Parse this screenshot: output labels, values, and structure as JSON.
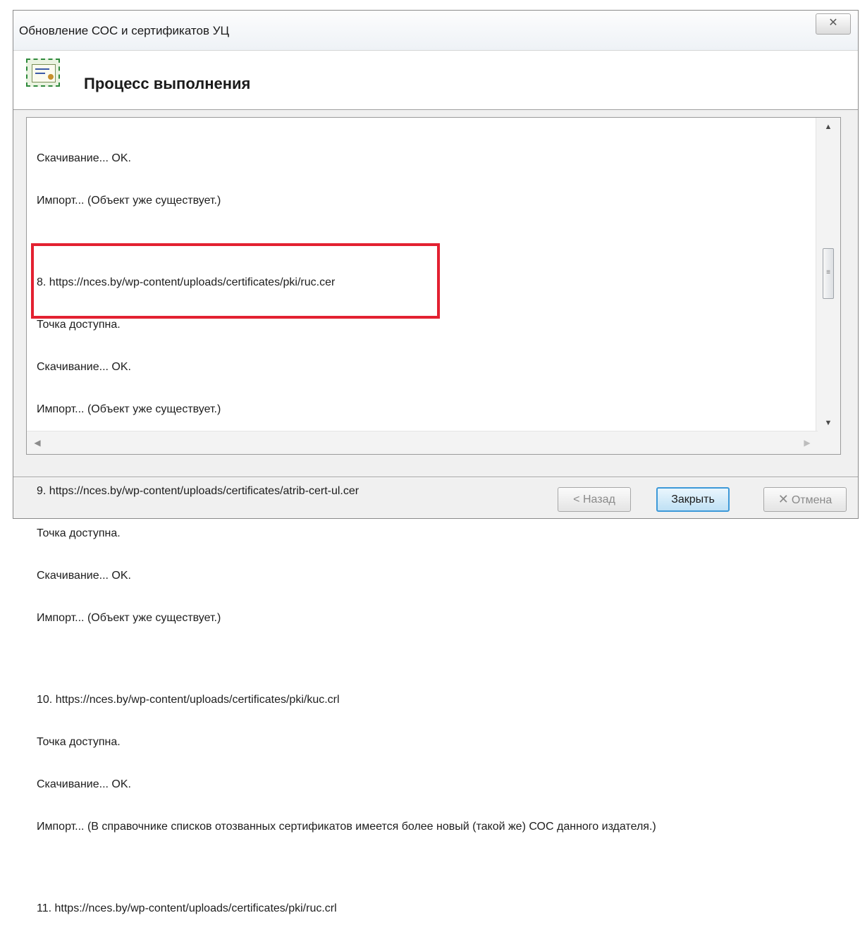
{
  "window": {
    "title": "Обновление СОС и сертификатов УЦ",
    "close_glyph": "✕"
  },
  "header": {
    "title": "Процесс выполнения",
    "icon": "certificate-icon"
  },
  "log": {
    "lines": [
      "Скачивание... OK.",
      "Импорт... (Объект уже существует.)",
      "",
      "8. https://nces.by/wp-content/uploads/certificates/pki/ruc.cer",
      "Точка доступна.",
      "Скачивание... OK.",
      "Импорт... (Объект уже существует.)",
      "",
      "9. https://nces.by/wp-content/uploads/certificates/atrib-cert-ul.cer",
      "Точка доступна.",
      "Скачивание... OK.",
      "Импорт... (Объект уже существует.)",
      "",
      "10. https://nces.by/wp-content/uploads/certificates/pki/kuc.crl",
      "Точка доступна.",
      "Скачивание... OK.",
      "Импорт... (В справочнике списков отозванных сертификатов имеется более новый (такой же) СОС данного издателя.)",
      "",
      "11. https://nces.by/wp-content/uploads/certificates/pki/ruc.crl"
    ],
    "highlight_color": "#e32131"
  },
  "buttons": {
    "back_label": "< Назад",
    "close_label": "Закрыть",
    "cancel_label": "Отмена",
    "cancel_glyph": "✕"
  },
  "colors": {
    "accent": "#3d99d8",
    "highlight": "#e32131"
  }
}
